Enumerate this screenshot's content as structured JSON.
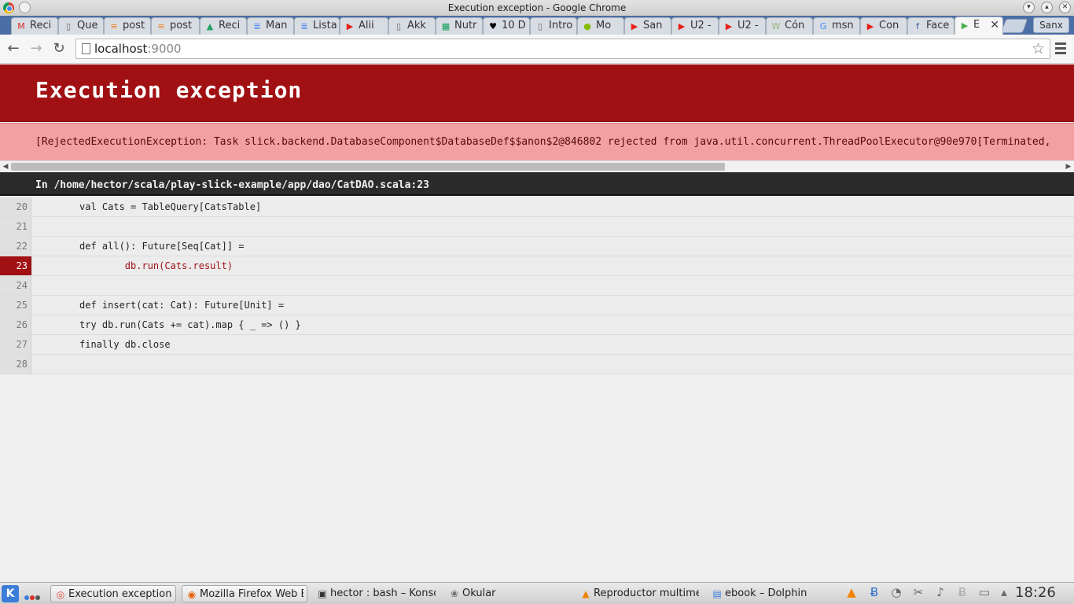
{
  "window": {
    "title": "Execution exception - Google Chrome"
  },
  "tabs": [
    {
      "label": "Reci",
      "icon": "gmail-icon",
      "glyph": "M",
      "color": "#d93025",
      "active": false
    },
    {
      "label": "Que",
      "icon": "page-icon",
      "glyph": "▯",
      "color": "#666666",
      "active": false
    },
    {
      "label": "post",
      "icon": "stackoverflow-icon",
      "glyph": "≡",
      "color": "#f48024",
      "active": false
    },
    {
      "label": "post",
      "icon": "stackoverflow-icon",
      "glyph": "≡",
      "color": "#f48024",
      "active": false
    },
    {
      "label": "Reci",
      "icon": "drive-icon",
      "glyph": "▲",
      "color": "#1fa463",
      "active": false
    },
    {
      "label": "Man",
      "icon": "docs-icon",
      "glyph": "≣",
      "color": "#4285f4",
      "active": false
    },
    {
      "label": "Lista",
      "icon": "docs-icon",
      "glyph": "≣",
      "color": "#4285f4",
      "active": false
    },
    {
      "label": "Alii",
      "icon": "youtube-icon",
      "glyph": "▶",
      "color": "#e62117",
      "active": false
    },
    {
      "label": "Akk",
      "icon": "page-icon",
      "glyph": "▯",
      "color": "#666666",
      "active": false
    },
    {
      "label": "Nutr",
      "icon": "sheets-icon",
      "glyph": "▦",
      "color": "#0f9d58",
      "active": false
    },
    {
      "label": "10 D",
      "icon": "heart-icon",
      "glyph": "♥",
      "color": "#000000",
      "active": false
    },
    {
      "label": "Intro",
      "icon": "page-icon",
      "glyph": "▯",
      "color": "#666666",
      "active": false
    },
    {
      "label": "Mo",
      "icon": "spotify-icon",
      "glyph": "●",
      "color": "#84bd00",
      "active": false
    },
    {
      "label": "San",
      "icon": "youtube-icon",
      "glyph": "▶",
      "color": "#e62117",
      "active": false
    },
    {
      "label": "U2 -",
      "icon": "youtube-icon",
      "glyph": "▶",
      "color": "#e62117",
      "active": false
    },
    {
      "label": "U2 -",
      "icon": "youtube-icon",
      "glyph": "▶",
      "color": "#e62117",
      "active": false
    },
    {
      "label": "Cón",
      "icon": "wikihow-icon",
      "glyph": "W",
      "color": "#93b874",
      "active": false
    },
    {
      "label": "msn",
      "icon": "google-icon",
      "glyph": "G",
      "color": "#4285f4",
      "active": false
    },
    {
      "label": "Con",
      "icon": "youtube-icon",
      "glyph": "▶",
      "color": "#e62117",
      "active": false
    },
    {
      "label": "Face",
      "icon": "facebook-icon",
      "glyph": "f",
      "color": "#3b5998",
      "active": false
    },
    {
      "label": "E",
      "icon": "play-icon",
      "glyph": "▶",
      "color": "#4caf50",
      "active": true
    }
  ],
  "profile": {
    "label": "Sanx"
  },
  "address_bar": {
    "host": "localhost",
    "port": ":9000"
  },
  "page": {
    "title": "Execution exception",
    "message": "[RejectedExecutionException: Task slick.backend.DatabaseComponent$DatabaseDef$$anon$2@846802 rejected from java.util.concurrent.ThreadPoolExecutor@90e970[Terminated,",
    "source_location": "In /home/hector/scala/play-slick-example/app/dao/CatDAO.scala:23",
    "error_line": "23",
    "code_lines": [
      {
        "num": "20",
        "text": "val Cats = TableQuery[CatsTable]"
      },
      {
        "num": "21",
        "text": ""
      },
      {
        "num": "22",
        "text": "def all(): Future[Seq[Cat]] ="
      },
      {
        "num": "23",
        "text": "        db.run(Cats.result)"
      },
      {
        "num": "24",
        "text": ""
      },
      {
        "num": "25",
        "text": "def insert(cat: Cat): Future[Unit] ="
      },
      {
        "num": "26",
        "text": "try db.run(Cats += cat).map { _ => () }"
      },
      {
        "num": "27",
        "text": "finally db.close"
      },
      {
        "num": "28",
        "text": ""
      }
    ]
  },
  "taskbar": {
    "tasks": [
      {
        "label": "Execution exception",
        "icon": "chrome-icon",
        "glyph": "◎",
        "color": "#db4437",
        "button": true
      },
      {
        "label": "Mozilla Firefox Web Br",
        "icon": "firefox-icon",
        "glyph": "◉",
        "color": "#e66000",
        "button": true
      },
      {
        "label": "hector : bash – Konso",
        "icon": "terminal-icon",
        "glyph": "▣",
        "color": "#333333",
        "button": false
      },
      {
        "label": "Okular",
        "icon": "okular-icon",
        "glyph": "❀",
        "color": "#6b6b6b",
        "button": false
      },
      {
        "label": "Reproductor multime",
        "icon": "vlc-icon",
        "glyph": "▲",
        "color": "#f08300",
        "button": false
      },
      {
        "label": "ebook – Dolphin",
        "icon": "dolphin-icon",
        "glyph": "▤",
        "color": "#3b7dd8",
        "button": false
      }
    ],
    "tray": [
      {
        "icon": "vlc-tray-icon",
        "glyph": "▲",
        "color": "#f08300"
      },
      {
        "icon": "bluetooth-icon",
        "glyph": "Ƀ",
        "color": "#2a6fc9"
      },
      {
        "icon": "network-icon",
        "glyph": "◔",
        "color": "#666666"
      },
      {
        "icon": "clipboard-scissors-icon",
        "glyph": "✂",
        "color": "#666666"
      },
      {
        "icon": "volume-icon",
        "glyph": "♪",
        "color": "#666666"
      },
      {
        "icon": "bluetooth-off-icon",
        "glyph": "Ƀ",
        "color": "#aaaaaa"
      },
      {
        "icon": "display-icon",
        "glyph": "▭",
        "color": "#666666"
      },
      {
        "icon": "tray-expand-icon",
        "glyph": "▴",
        "color": "#666666"
      }
    ],
    "clock": "18:26"
  },
  "colors": {
    "error_red": "#a11013",
    "message_bg": "#f2a0a2",
    "tabstrip": "#4b6ea4"
  }
}
